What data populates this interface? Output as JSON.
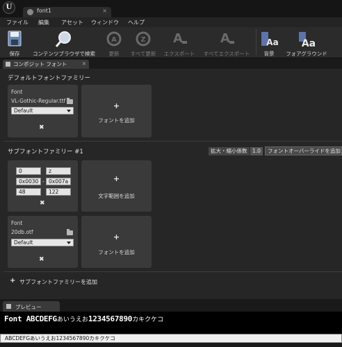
{
  "window": {
    "tab_title": "font1",
    "close_glyph": "×"
  },
  "menu": {
    "items": [
      "ファイル",
      "編集",
      "アセット",
      "ウィンドウ",
      "ヘルプ"
    ]
  },
  "toolbar": {
    "save": "保存",
    "browse": "コンテンツブラウザで検索",
    "update": "更新",
    "update_all": "すべて更新",
    "export": "エクスポート",
    "export_all": "すべてエクスポート",
    "background": "背景",
    "foreground": "フォアグラウンド"
  },
  "panel_tab": {
    "label": "コンポジット フォント",
    "close": "×"
  },
  "default_family": {
    "title": "デフォルトフォントファミリー",
    "font_label": "Font",
    "font_file": "VL-Gothic-Regular.ttf",
    "style": "Default",
    "add_font": "フォントを追加"
  },
  "sub_family": {
    "title": "サブフォントファミリー #1",
    "scale_label": "拡大・縮小係数",
    "scale_value": "1.0",
    "override_button": "フォントオーバーライドを追加",
    "range": {
      "start_char": "0",
      "end_char": "z",
      "start_hex": "0x0030",
      "end_hex": "0x007a",
      "start_dec": "48",
      "end_dec": "122",
      "dash": "-"
    },
    "add_range": "文字範囲を追加",
    "font_label": "Font",
    "font_file": "20db.otf",
    "style": "Default",
    "add_font": "フォントを追加"
  },
  "add_subfamily": "サブフォントファミリーを追加",
  "preview": {
    "tab_label": "プレビュー",
    "latin_text": "Font ABCDEFG",
    "kana_text": "あいうえお",
    "digits_text": "1234567890",
    "katakana_text": "カキクケコ",
    "input_value": "ABCDEFGあいうえお1234567890カキクケコ"
  }
}
